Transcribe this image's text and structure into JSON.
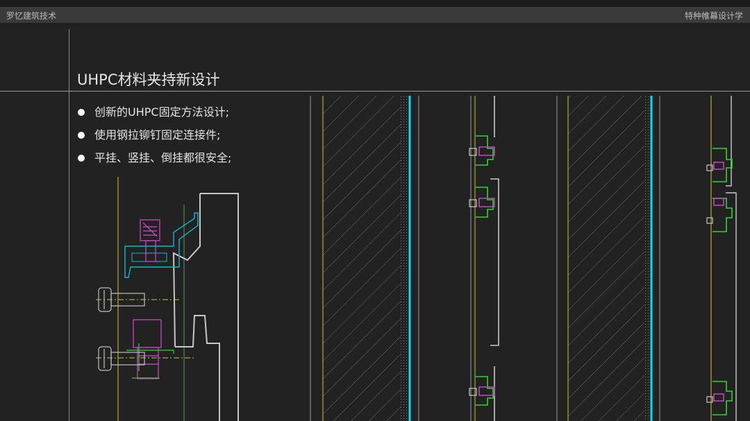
{
  "header": {
    "left": "罗忆建筑技术",
    "right": "特种帷幕设计学"
  },
  "title": "UHPC材料夹持新设计",
  "bullets": [
    "创新的UHPC固定方法设计;",
    "使用钢拉铆钉固定连接件;",
    "平挂、竖挂、倒挂都很安全;"
  ],
  "colors": {
    "background": "#222222",
    "header_bar": "#3a3a3a",
    "cyan": "#19d6ee",
    "yellow": "#c8c83a",
    "green": "#2fd52f",
    "magenta": "#d24ad2",
    "gray_line": "#9a9a9a"
  },
  "figures": [
    {
      "name": "detail-section",
      "icons": [
        "bolt-icon",
        "bolt-icon"
      ]
    },
    {
      "name": "wall-section-hatched-1"
    },
    {
      "name": "bracket-column-1"
    },
    {
      "name": "wall-section-hatched-2"
    },
    {
      "name": "bracket-column-2"
    }
  ]
}
